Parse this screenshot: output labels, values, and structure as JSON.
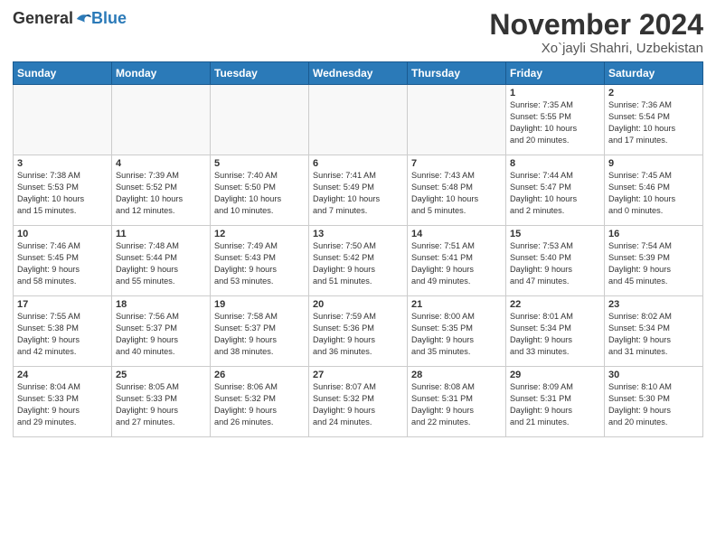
{
  "header": {
    "logo_general": "General",
    "logo_blue": "Blue",
    "title": "November 2024",
    "subtitle": "Xo`jayli Shahri, Uzbekistan"
  },
  "weekdays": [
    "Sunday",
    "Monday",
    "Tuesday",
    "Wednesday",
    "Thursday",
    "Friday",
    "Saturday"
  ],
  "weeks": [
    [
      {
        "day": "",
        "info": ""
      },
      {
        "day": "",
        "info": ""
      },
      {
        "day": "",
        "info": ""
      },
      {
        "day": "",
        "info": ""
      },
      {
        "day": "",
        "info": ""
      },
      {
        "day": "1",
        "info": "Sunrise: 7:35 AM\nSunset: 5:55 PM\nDaylight: 10 hours\nand 20 minutes."
      },
      {
        "day": "2",
        "info": "Sunrise: 7:36 AM\nSunset: 5:54 PM\nDaylight: 10 hours\nand 17 minutes."
      }
    ],
    [
      {
        "day": "3",
        "info": "Sunrise: 7:38 AM\nSunset: 5:53 PM\nDaylight: 10 hours\nand 15 minutes."
      },
      {
        "day": "4",
        "info": "Sunrise: 7:39 AM\nSunset: 5:52 PM\nDaylight: 10 hours\nand 12 minutes."
      },
      {
        "day": "5",
        "info": "Sunrise: 7:40 AM\nSunset: 5:50 PM\nDaylight: 10 hours\nand 10 minutes."
      },
      {
        "day": "6",
        "info": "Sunrise: 7:41 AM\nSunset: 5:49 PM\nDaylight: 10 hours\nand 7 minutes."
      },
      {
        "day": "7",
        "info": "Sunrise: 7:43 AM\nSunset: 5:48 PM\nDaylight: 10 hours\nand 5 minutes."
      },
      {
        "day": "8",
        "info": "Sunrise: 7:44 AM\nSunset: 5:47 PM\nDaylight: 10 hours\nand 2 minutes."
      },
      {
        "day": "9",
        "info": "Sunrise: 7:45 AM\nSunset: 5:46 PM\nDaylight: 10 hours\nand 0 minutes."
      }
    ],
    [
      {
        "day": "10",
        "info": "Sunrise: 7:46 AM\nSunset: 5:45 PM\nDaylight: 9 hours\nand 58 minutes."
      },
      {
        "day": "11",
        "info": "Sunrise: 7:48 AM\nSunset: 5:44 PM\nDaylight: 9 hours\nand 55 minutes."
      },
      {
        "day": "12",
        "info": "Sunrise: 7:49 AM\nSunset: 5:43 PM\nDaylight: 9 hours\nand 53 minutes."
      },
      {
        "day": "13",
        "info": "Sunrise: 7:50 AM\nSunset: 5:42 PM\nDaylight: 9 hours\nand 51 minutes."
      },
      {
        "day": "14",
        "info": "Sunrise: 7:51 AM\nSunset: 5:41 PM\nDaylight: 9 hours\nand 49 minutes."
      },
      {
        "day": "15",
        "info": "Sunrise: 7:53 AM\nSunset: 5:40 PM\nDaylight: 9 hours\nand 47 minutes."
      },
      {
        "day": "16",
        "info": "Sunrise: 7:54 AM\nSunset: 5:39 PM\nDaylight: 9 hours\nand 45 minutes."
      }
    ],
    [
      {
        "day": "17",
        "info": "Sunrise: 7:55 AM\nSunset: 5:38 PM\nDaylight: 9 hours\nand 42 minutes."
      },
      {
        "day": "18",
        "info": "Sunrise: 7:56 AM\nSunset: 5:37 PM\nDaylight: 9 hours\nand 40 minutes."
      },
      {
        "day": "19",
        "info": "Sunrise: 7:58 AM\nSunset: 5:37 PM\nDaylight: 9 hours\nand 38 minutes."
      },
      {
        "day": "20",
        "info": "Sunrise: 7:59 AM\nSunset: 5:36 PM\nDaylight: 9 hours\nand 36 minutes."
      },
      {
        "day": "21",
        "info": "Sunrise: 8:00 AM\nSunset: 5:35 PM\nDaylight: 9 hours\nand 35 minutes."
      },
      {
        "day": "22",
        "info": "Sunrise: 8:01 AM\nSunset: 5:34 PM\nDaylight: 9 hours\nand 33 minutes."
      },
      {
        "day": "23",
        "info": "Sunrise: 8:02 AM\nSunset: 5:34 PM\nDaylight: 9 hours\nand 31 minutes."
      }
    ],
    [
      {
        "day": "24",
        "info": "Sunrise: 8:04 AM\nSunset: 5:33 PM\nDaylight: 9 hours\nand 29 minutes."
      },
      {
        "day": "25",
        "info": "Sunrise: 8:05 AM\nSunset: 5:33 PM\nDaylight: 9 hours\nand 27 minutes."
      },
      {
        "day": "26",
        "info": "Sunrise: 8:06 AM\nSunset: 5:32 PM\nDaylight: 9 hours\nand 26 minutes."
      },
      {
        "day": "27",
        "info": "Sunrise: 8:07 AM\nSunset: 5:32 PM\nDaylight: 9 hours\nand 24 minutes."
      },
      {
        "day": "28",
        "info": "Sunrise: 8:08 AM\nSunset: 5:31 PM\nDaylight: 9 hours\nand 22 minutes."
      },
      {
        "day": "29",
        "info": "Sunrise: 8:09 AM\nSunset: 5:31 PM\nDaylight: 9 hours\nand 21 minutes."
      },
      {
        "day": "30",
        "info": "Sunrise: 8:10 AM\nSunset: 5:30 PM\nDaylight: 9 hours\nand 20 minutes."
      }
    ]
  ]
}
